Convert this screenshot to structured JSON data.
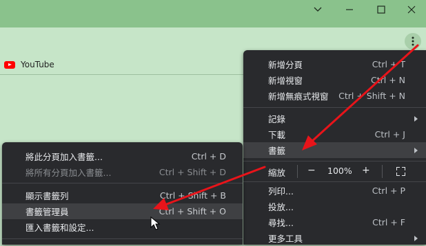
{
  "window": {
    "controls": [
      "chevron-down",
      "minimize",
      "maximize",
      "close"
    ]
  },
  "bookmarks_bar": {
    "items": [
      {
        "label": "YouTube",
        "icon": "youtube-icon"
      }
    ]
  },
  "main_menu": {
    "items": [
      {
        "label": "新增分頁",
        "shortcut": "Ctrl + T"
      },
      {
        "label": "新增視窗",
        "shortcut": "Ctrl + N"
      },
      {
        "label": "新增無痕式視窗",
        "shortcut": "Ctrl + Shift + N"
      },
      {
        "label": "記錄",
        "shortcut": ""
      },
      {
        "label": "下載",
        "shortcut": "Ctrl + J"
      },
      {
        "label": "書籤",
        "shortcut": ""
      },
      {
        "label": "列印...",
        "shortcut": "Ctrl + P"
      },
      {
        "label": "投放...",
        "shortcut": ""
      },
      {
        "label": "尋找...",
        "shortcut": "Ctrl + F"
      },
      {
        "label": "更多工具",
        "shortcut": ""
      }
    ],
    "zoom": {
      "label": "縮放",
      "minus": "−",
      "value": "100%",
      "plus": "+"
    }
  },
  "bookmarks_submenu": {
    "items": [
      {
        "label": "將此分頁加入書籤...",
        "shortcut": "Ctrl + D"
      },
      {
        "label": "將所有分頁加入書籤...",
        "shortcut": "Ctrl + Shift + D"
      },
      {
        "label": "顯示書籤列",
        "shortcut": "Ctrl + Shift + B"
      },
      {
        "label": "書籤管理員",
        "shortcut": "Ctrl + Shift + O"
      },
      {
        "label": "匯入書籤和設定...",
        "shortcut": ""
      }
    ]
  },
  "colors": {
    "titlebar": "#8ac28c",
    "toolbar": "#c6e5c8",
    "menu_bg": "#292a2d",
    "highlight": "#3f4043",
    "annotation_arrow": "#e8141a"
  }
}
